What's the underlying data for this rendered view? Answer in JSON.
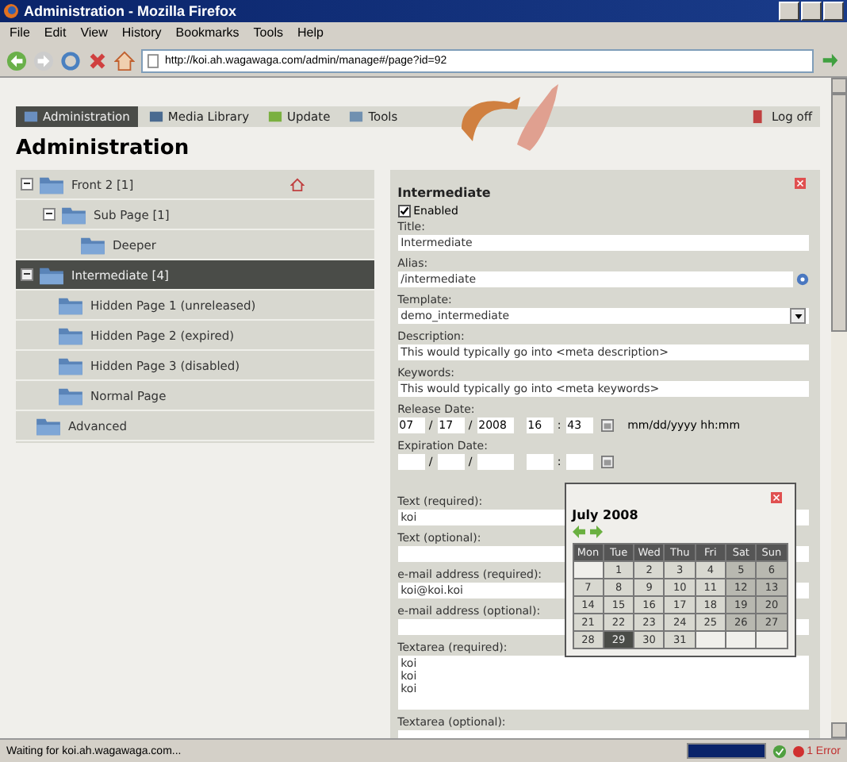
{
  "window": {
    "title": "Administration - Mozilla Firefox"
  },
  "menu": [
    "File",
    "Edit",
    "View",
    "History",
    "Bookmarks",
    "Tools",
    "Help"
  ],
  "address_bar": {
    "value": "http://koi.ah.wagawaga.com/admin/manage#/page?id=92"
  },
  "nav": [
    {
      "label": "Administration",
      "selected": true
    },
    {
      "label": "Media Library",
      "selected": false
    },
    {
      "label": "Update",
      "selected": false
    },
    {
      "label": "Tools",
      "selected": false
    }
  ],
  "logoff": "Log off",
  "heading": "Administration",
  "tree": [
    {
      "label": "Front 2 [1]",
      "home": true,
      "expanded": true,
      "selected": false,
      "children": [
        {
          "label": "Sub Page [1]",
          "expanded": true,
          "selected": false,
          "children": [
            {
              "label": "Deeper",
              "selected": false
            }
          ]
        }
      ]
    },
    {
      "label": "Intermediate [4]",
      "expanded": true,
      "selected": true,
      "children": [
        {
          "label": "Hidden Page 1 (unreleased)",
          "selected": false
        },
        {
          "label": "Hidden Page 2 (expired)",
          "selected": false
        },
        {
          "label": "Hidden Page 3 (disabled)",
          "selected": false
        },
        {
          "label": "Normal Page",
          "selected": false
        }
      ]
    },
    {
      "label": "Advanced",
      "selected": false
    }
  ],
  "editor": {
    "title": "Intermediate",
    "enabled": {
      "label": "Enabled",
      "checked": true
    },
    "fields": [
      {
        "kind": "text",
        "label": "Title:",
        "value": "Intermediate"
      },
      {
        "kind": "help",
        "label": "Alias:",
        "value": "/intermediate"
      },
      {
        "kind": "select",
        "label": "Template:",
        "value": "demo_intermediate"
      },
      {
        "kind": "text",
        "label": "Description:",
        "value": "This would typically go into <meta description>"
      },
      {
        "kind": "text",
        "label": "Keywords:",
        "value": "This would typically go into <meta keywords>"
      },
      {
        "kind": "date",
        "label": "Release Date:",
        "parts": [
          "07",
          "17",
          "2008",
          "16",
          "43"
        ],
        "separators": [
          "/",
          "/",
          ":"
        ],
        "hint": "mm/dd/yyyy hh:mm"
      },
      {
        "kind": "date",
        "label": "Expiration Date:",
        "separators": [
          "/",
          "/",
          ":"
        ]
      },
      {
        "kind": "text",
        "label": "Text (required):",
        "value": "koi"
      },
      {
        "kind": "text",
        "label": "Text (optional):"
      },
      {
        "kind": "text",
        "label": "e-mail address (required):",
        "value": "koi@koi.koi"
      },
      {
        "kind": "text",
        "label": "e-mail address (optional):"
      },
      {
        "kind": "textarea",
        "label": "Textarea (required):",
        "value": "koi\nkoi\nkoi"
      },
      {
        "kind": "textarea",
        "label": "Textarea (optional):"
      }
    ]
  },
  "calendar": {
    "title": "July 2008",
    "weekdays": [
      "Mon",
      "Tue",
      "Wed",
      "Thu",
      "Fri",
      "Sat",
      "Sun"
    ],
    "weeks": [
      [
        {
          "kind": "blank"
        },
        {
          "kind": "day",
          "day": "1",
          "selected": false
        },
        {
          "day": "2",
          "selected": false
        },
        {
          "day": "3",
          "selected": false
        },
        {
          "day": "4",
          "selected": false
        },
        {
          "day": "5",
          "selected": false
        },
        {
          "day": "6",
          "selected": false
        }
      ],
      [
        {
          "day": "7",
          "selected": false
        },
        {
          "day": "8",
          "selected": false
        },
        {
          "day": "9",
          "selected": false
        },
        {
          "day": "10",
          "selected": false
        },
        {
          "day": "11",
          "selected": false
        },
        {
          "day": "12",
          "selected": false
        },
        {
          "day": "13",
          "selected": false
        }
      ],
      [
        {
          "day": "14",
          "selected": false
        },
        {
          "day": "15",
          "selected": false
        },
        {
          "day": "16",
          "selected": false
        },
        {
          "day": "17",
          "selected": false
        },
        {
          "day": "18",
          "selected": false
        },
        {
          "day": "19",
          "selected": false
        },
        {
          "day": "20",
          "selected": false
        }
      ],
      [
        {
          "day": "21",
          "selected": false
        },
        {
          "day": "22",
          "selected": false
        },
        {
          "day": "23",
          "selected": false
        },
        {
          "day": "24",
          "selected": false
        },
        {
          "day": "25",
          "selected": false
        },
        {
          "day": "26",
          "selected": false
        },
        {
          "day": "27",
          "selected": false
        }
      ],
      [
        {
          "day": "28",
          "selected": false
        },
        {
          "day": "29",
          "selected": true
        },
        {
          "day": "30",
          "selected": false
        },
        {
          "day": "31",
          "selected": false
        },
        {
          "kind": "blank"
        },
        {
          "kind": "blank"
        },
        {
          "kind": "blank"
        }
      ]
    ]
  },
  "status_bar": {
    "text": "Waiting for koi.ah.wagawaga.com...",
    "progress": {
      "level": 1
    },
    "errors": "1 Error"
  }
}
